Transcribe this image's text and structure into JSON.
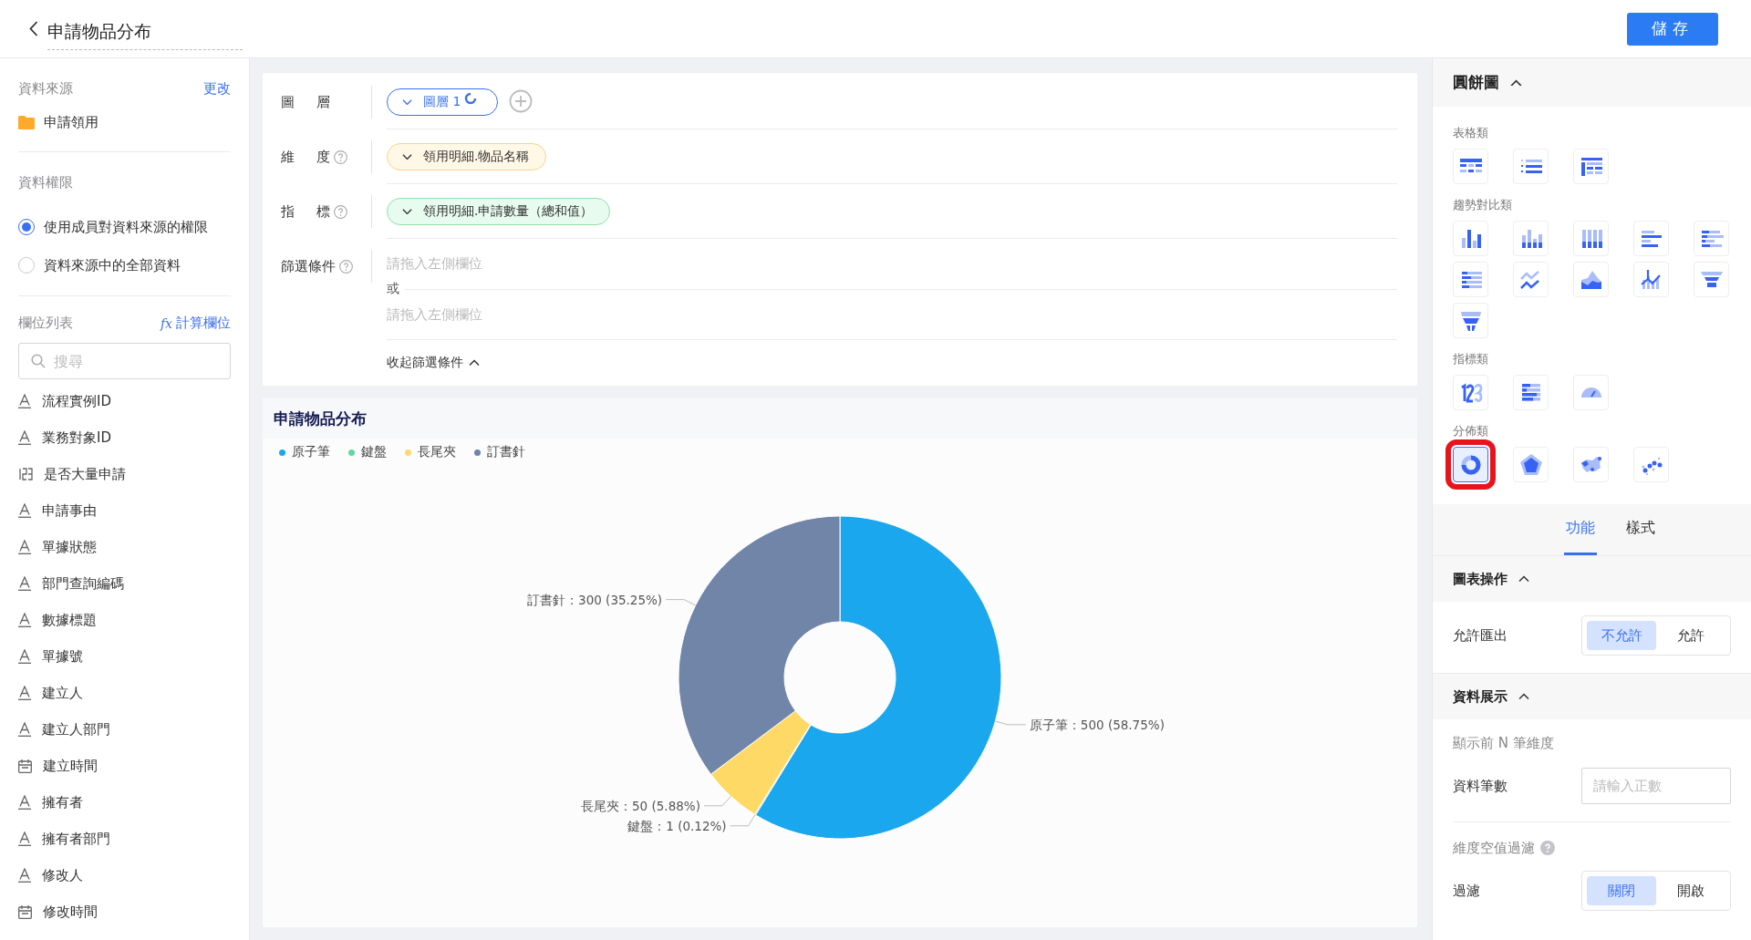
{
  "header": {
    "title": "申請物品分布",
    "save_button": "儲存"
  },
  "sidebar": {
    "data_source": {
      "label": "資料來源",
      "change_link": "更改",
      "name": "申請領用"
    },
    "permission": {
      "label": "資料權限",
      "options": [
        {
          "label": "使用成員對資料來源的權限",
          "selected": true
        },
        {
          "label": "資料來源中的全部資料",
          "selected": false
        }
      ]
    },
    "fields": {
      "label": "欄位列表",
      "calc_icon": "fx",
      "calc_link": "計算欄位",
      "search": {
        "placeholder": "搜尋"
      },
      "items": [
        {
          "name": "流程實例ID",
          "kind": "text"
        },
        {
          "name": "業務對象ID",
          "kind": "text"
        },
        {
          "name": "是否大量申請",
          "kind": "number"
        },
        {
          "name": "申請事由",
          "kind": "text"
        },
        {
          "name": "單據狀態",
          "kind": "text"
        },
        {
          "name": "部門查詢編碼",
          "kind": "text"
        },
        {
          "name": "數據標題",
          "kind": "text"
        },
        {
          "name": "單據號",
          "kind": "text"
        },
        {
          "name": "建立人",
          "kind": "text"
        },
        {
          "name": "建立人部門",
          "kind": "text"
        },
        {
          "name": "建立時間",
          "kind": "date"
        },
        {
          "name": "擁有者",
          "kind": "text"
        },
        {
          "name": "擁有者部門",
          "kind": "text"
        },
        {
          "name": "修改人",
          "kind": "text"
        },
        {
          "name": "修改時間",
          "kind": "date"
        }
      ]
    }
  },
  "config": {
    "layer": {
      "label": "圖層",
      "chip": "圖層 1"
    },
    "dimension": {
      "label": "維度",
      "help": true,
      "chip": "領用明細.物品名稱",
      "kind": "dimension"
    },
    "metric": {
      "label": "指標",
      "help": true,
      "chip": "領用明細.申請數量（總和值）",
      "kind": "metric"
    },
    "filter": {
      "label": "篩選條件",
      "help": true,
      "placeholders": [
        "請拖入左側欄位",
        "請拖入左側欄位"
      ],
      "or": "或",
      "collapse": "收起篩選條件"
    }
  },
  "chart_card": {
    "title": "申請物品分布",
    "legend": [
      {
        "label": "原子筆",
        "color": "#1aa7ee"
      },
      {
        "label": "鍵盤",
        "color": "#5fd8a5"
      },
      {
        "label": "長尾夾",
        "color": "#ffd966"
      },
      {
        "label": "訂書針",
        "color": "#7185a8"
      }
    ],
    "chart_data": {
      "type": "donut",
      "categories": [
        "原子筆",
        "鍵盤",
        "長尾夾",
        "訂書針"
      ],
      "values": [
        58.75,
        0.12,
        5.88,
        35.25
      ],
      "value_labels": [
        "：500 (58.75%)",
        "：1 (0.12%)",
        "：50 (5.88%)",
        "：300 (35.25%)"
      ]
    }
  },
  "panel": {
    "title": "圓餅圖",
    "groups": [
      {
        "label": "表格類",
        "items": [
          {
            "kind": "table",
            "selected": false
          },
          {
            "kind": "list",
            "selected": false
          },
          {
            "kind": "pivot",
            "selected": false
          }
        ]
      },
      {
        "label": "趨勢對比類",
        "items": [
          {
            "kind": "bar",
            "selected": false
          },
          {
            "kind": "grouped-bar",
            "selected": false
          },
          {
            "kind": "stacked-bar",
            "selected": false
          },
          {
            "kind": "hbar",
            "selected": false
          },
          {
            "kind": "hbar-stacked",
            "selected": false
          },
          {
            "kind": "hbar-percent",
            "selected": false
          },
          {
            "kind": "line",
            "selected": false
          },
          {
            "kind": "area",
            "selected": false
          },
          {
            "kind": "combo",
            "selected": false
          },
          {
            "kind": "funnel",
            "selected": false
          },
          {
            "kind": "funnel-split",
            "selected": false
          }
        ]
      },
      {
        "label": "指標類",
        "items": [
          {
            "kind": "number",
            "selected": false
          },
          {
            "kind": "progress",
            "selected": false
          },
          {
            "kind": "gauge",
            "selected": false
          }
        ]
      },
      {
        "label": "分佈類",
        "items": [
          {
            "kind": "donut",
            "selected": true
          },
          {
            "kind": "radar",
            "selected": false
          },
          {
            "kind": "map",
            "selected": false
          },
          {
            "kind": "scatter",
            "selected": false
          }
        ]
      }
    ],
    "tabs": [
      {
        "label": "功能",
        "selected": true
      },
      {
        "label": "樣式",
        "selected": false
      }
    ],
    "sections": [
      {
        "title": "圖表操作",
        "rows": [
          {
            "kind": "segmented",
            "label": "允許匯出",
            "options": [
              {
                "label": "不允許",
                "selected": true
              },
              {
                "label": "允許",
                "selected": false
              }
            ]
          }
        ]
      },
      {
        "title": "資料展示",
        "rows": [
          {
            "kind": "subtitle",
            "label": "顯示前 N 筆維度"
          },
          {
            "kind": "input",
            "label": "資料筆數",
            "placeholder": "請輸入正數"
          },
          {
            "kind": "divider"
          },
          {
            "kind": "subtitle",
            "label": "維度空值過濾",
            "help": true
          },
          {
            "kind": "segmented",
            "label": "過濾",
            "options": [
              {
                "label": "關閉",
                "selected": true
              },
              {
                "label": "開啟",
                "selected": false
              }
            ]
          }
        ]
      }
    ]
  }
}
